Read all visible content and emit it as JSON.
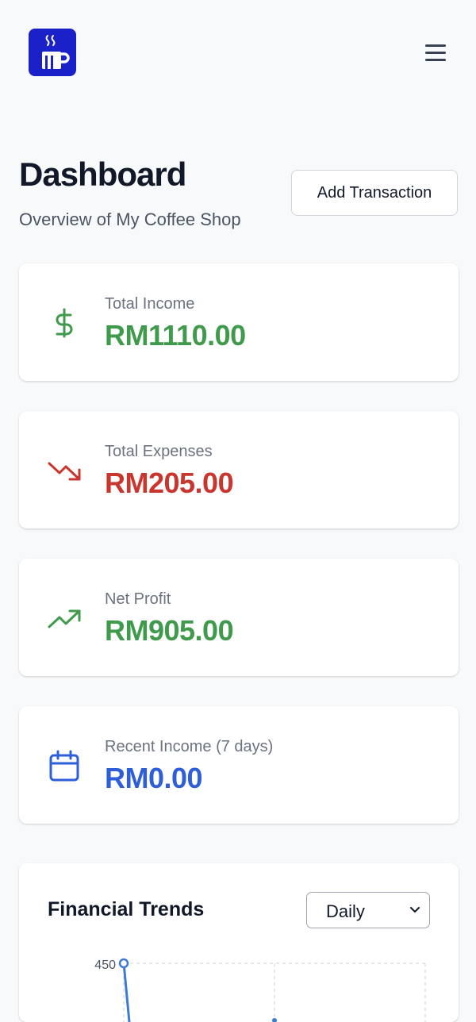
{
  "header": {
    "logo_icon": "coffee-cup-icon",
    "menu_icon": "hamburger-menu-icon"
  },
  "page": {
    "title": "Dashboard",
    "subtitle": "Overview of My Coffee Shop",
    "add_button_label": "Add Transaction"
  },
  "stats": [
    {
      "label": "Total Income",
      "value": "RM1110.00",
      "icon": "dollar-icon",
      "color": "#3f9a4c"
    },
    {
      "label": "Total Expenses",
      "value": "RM205.00",
      "icon": "trending-down-icon",
      "color": "#c8362e"
    },
    {
      "label": "Net Profit",
      "value": "RM905.00",
      "icon": "trending-up-icon",
      "color": "#3f9a4c"
    },
    {
      "label": "Recent Income (7 days)",
      "value": "RM0.00",
      "icon": "calendar-icon",
      "color": "#2e5fd8"
    }
  ],
  "trends": {
    "title": "Financial Trends",
    "period_selected": "Daily",
    "chart_data": {
      "type": "line",
      "y_ticks": [
        "450"
      ],
      "series": [
        {
          "color": "#3b7bd6",
          "values": [
            450
          ]
        }
      ],
      "grid": true
    }
  }
}
